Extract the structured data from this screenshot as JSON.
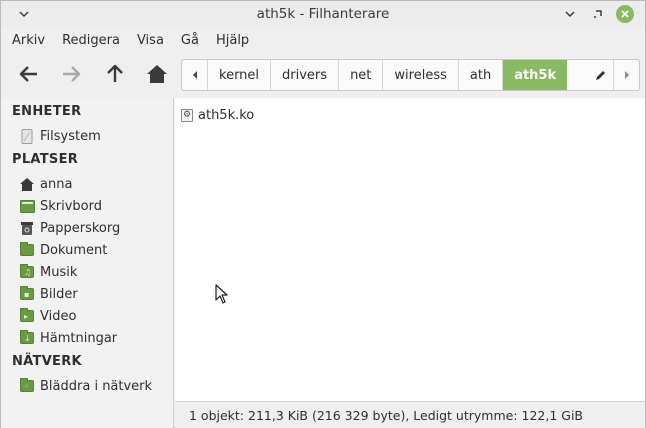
{
  "window": {
    "title": "ath5k - Filhanterare"
  },
  "menubar": {
    "items": [
      "Arkiv",
      "Redigera",
      "Visa",
      "Gå",
      "Hjälp"
    ]
  },
  "pathbar": {
    "crumbs": [
      "kernel",
      "drivers",
      "net",
      "wireless",
      "ath",
      "ath5k"
    ]
  },
  "sidebar": {
    "devices_header": "ENHETER",
    "devices": [
      {
        "label": "Filsystem",
        "icon": "drive-icon"
      }
    ],
    "places_header": "PLATSER",
    "places": [
      {
        "label": "anna",
        "icon": "home-icon"
      },
      {
        "label": "Skrivbord",
        "icon": "desktop-icon"
      },
      {
        "label": "Papperskorg",
        "icon": "trash-icon"
      },
      {
        "label": "Dokument",
        "icon": "documents-folder-icon"
      },
      {
        "label": "Musik",
        "icon": "music-folder-icon"
      },
      {
        "label": "Bilder",
        "icon": "pictures-folder-icon"
      },
      {
        "label": "Video",
        "icon": "video-folder-icon"
      },
      {
        "label": "Hämtningar",
        "icon": "downloads-folder-icon"
      }
    ],
    "network_header": "NÄTVERK",
    "network": [
      {
        "label": "Bläddra i nätverk",
        "icon": "network-icon"
      }
    ]
  },
  "main": {
    "files": [
      {
        "name": "ath5k.ko",
        "icon": "kernel-module-icon"
      }
    ]
  },
  "statusbar": {
    "text": "1 objekt: 211,3 KiB (216 329 byte), Ledigt utrymme: 122,1 GiB"
  },
  "colors": {
    "accent": "#8ab963",
    "folder": "#6b9a43"
  }
}
